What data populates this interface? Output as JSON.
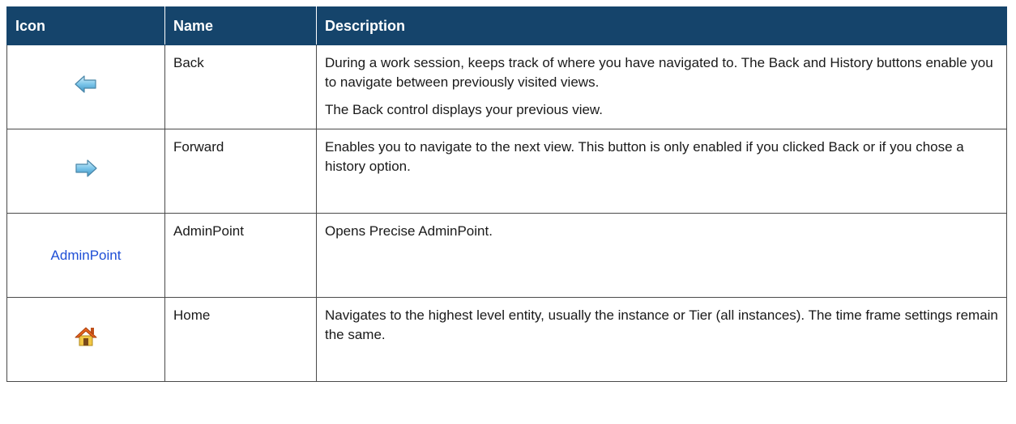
{
  "table": {
    "headers": {
      "icon": "Icon",
      "name": "Name",
      "description": "Description"
    },
    "rows": [
      {
        "icon": "back-arrow-icon",
        "name": "Back",
        "description": [
          "During a work session, keeps track of where you have navigated to. The Back and History buttons enable you to navigate between previously visited views.",
          "The Back control displays your previous view."
        ]
      },
      {
        "icon": "forward-arrow-icon",
        "name": "Forward",
        "description": [
          "Enables you to navigate to the next view. This button is only enabled if you clicked Back or if you chose a history option."
        ]
      },
      {
        "icon": "adminpoint-link",
        "icon_text": "AdminPoint",
        "name": "AdminPoint",
        "description": [
          "Opens Precise AdminPoint."
        ]
      },
      {
        "icon": "home-icon",
        "name": "Home",
        "description": [
          "Navigates to the highest level entity, usually the instance or Tier (all instances). The time frame settings remain the same."
        ]
      }
    ]
  },
  "colors": {
    "header_bg": "#15446b",
    "header_text": "#ffffff",
    "border": "#4a4a4a",
    "admin_link": "#1f4fd6",
    "arrow_fill": "#7cc6ea",
    "home_roof": "#e8641c",
    "home_wall": "#f2c744"
  }
}
